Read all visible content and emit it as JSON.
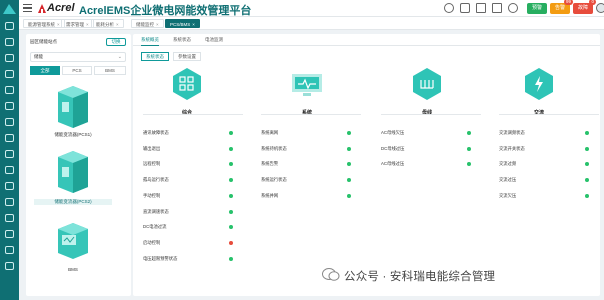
{
  "header": {
    "logo_text": "Acrel",
    "app_title": "AcrelEMS企业微电网能效管理平台",
    "buttons": [
      {
        "label": "预警",
        "color": "#27ae60",
        "badge": ""
      },
      {
        "label": "告警",
        "color": "#f39c12",
        "badge": "99"
      },
      {
        "label": "故障",
        "color": "#e74c3c",
        "badge": "0"
      }
    ]
  },
  "tabs": [
    {
      "label": "能源管理系统",
      "active": false
    },
    {
      "label": "需求管理",
      "active": false
    },
    {
      "label": "能耗分析",
      "active": false
    },
    {
      "label": "储能监控",
      "active": false
    },
    {
      "label": "PCS/BMS",
      "active": true
    }
  ],
  "left": {
    "title": "园区储能站点",
    "switch_label": "切换",
    "station_value": "储能",
    "filters": [
      "全部",
      "PCS",
      "BMS"
    ],
    "devices": [
      {
        "label": "储能变流器(PCS1)",
        "selected": false
      },
      {
        "label": "储能变流器(PCS2)",
        "selected": true
      },
      {
        "label": "BMS",
        "selected": false
      }
    ]
  },
  "main": {
    "tabs": [
      "系统概览",
      "系统状态",
      "电池监测"
    ],
    "subtabs": [
      "系统状态",
      "参数设置"
    ],
    "categories": [
      {
        "name": "综合",
        "icon": "grid-icon"
      },
      {
        "name": "系统",
        "icon": "monitor-icon"
      },
      {
        "name": "母线",
        "icon": "busbar-icon"
      },
      {
        "name": "交流",
        "icon": "ac-bolt-icon"
      }
    ],
    "columns": [
      {
        "items": [
          {
            "label": "通讯故障状态",
            "status": "ok"
          },
          {
            "label": "输出退出",
            "status": "ok"
          },
          {
            "label": "远程控制",
            "status": "ok"
          },
          {
            "label": "孤岛运行状态",
            "status": "ok"
          },
          {
            "label": "手动控制",
            "status": "ok"
          },
          {
            "label": "直流调速状态",
            "status": "ok"
          },
          {
            "label": "DC电池过流",
            "status": "ok"
          },
          {
            "label": "启动控制",
            "status": "alarm"
          },
          {
            "label": "电压超限预警状态",
            "status": "ok"
          }
        ]
      },
      {
        "items": [
          {
            "label": "系统离网",
            "status": "ok"
          },
          {
            "label": "系统待机状态",
            "status": "ok"
          },
          {
            "label": "系统告警",
            "status": "ok"
          },
          {
            "label": "系统运行状态",
            "status": "ok"
          },
          {
            "label": "系统并网",
            "status": "ok"
          }
        ]
      },
      {
        "items": [
          {
            "label": "AC母线欠压",
            "status": "ok"
          },
          {
            "label": "DC母线过压",
            "status": "ok"
          },
          {
            "label": "AC母线过压",
            "status": "ok"
          }
        ]
      },
      {
        "items": [
          {
            "label": "交流调频状态",
            "status": "ok"
          },
          {
            "label": "交流开关状态",
            "status": "ok"
          },
          {
            "label": "交流过频",
            "status": "ok"
          },
          {
            "label": "交流过压",
            "status": "ok"
          },
          {
            "label": "交流欠压",
            "status": "ok"
          }
        ]
      }
    ]
  },
  "colors": {
    "ok": "#27c26b",
    "alarm": "#e74c3c",
    "teal": "#0f6f73",
    "accent": "#2ec4b6"
  },
  "watermark": "公众号 · 安科瑞电能综合管理"
}
